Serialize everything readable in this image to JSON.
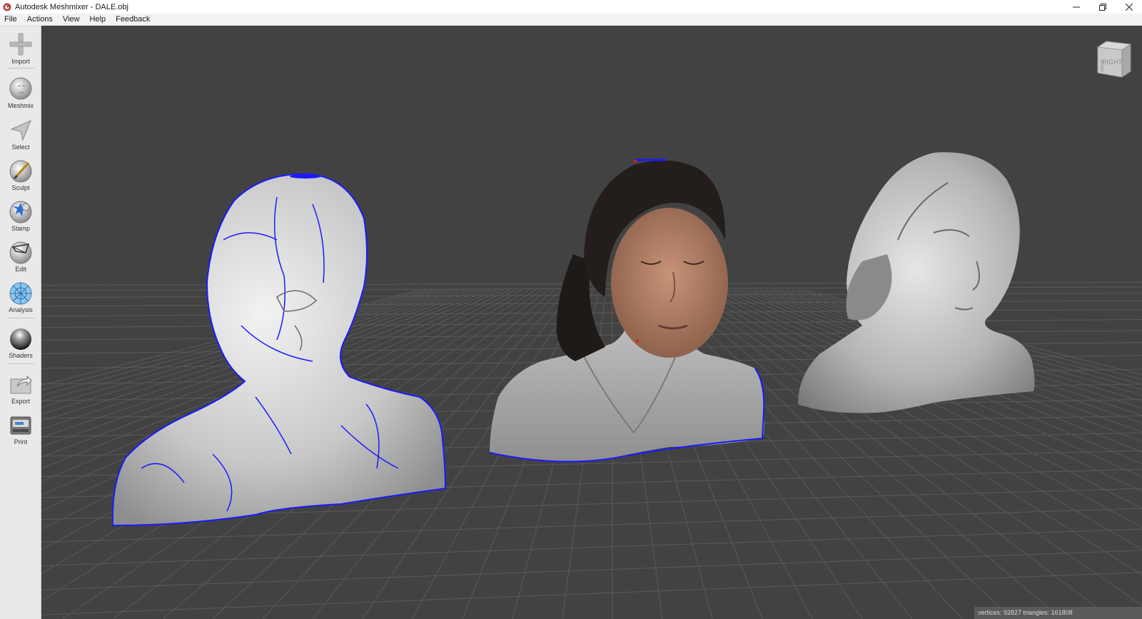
{
  "window": {
    "title": "Autodesk Meshmixer - DALE.obj",
    "minimize_icon": "minimize-icon",
    "restore_icon": "restore-icon",
    "close_icon": "close-icon"
  },
  "menu": {
    "items": [
      {
        "label": "File"
      },
      {
        "label": "Actions"
      },
      {
        "label": "View"
      },
      {
        "label": "Help"
      },
      {
        "label": "Feedback"
      }
    ]
  },
  "toolbar": {
    "tools": [
      {
        "label": "Import",
        "icon": "plus-icon"
      },
      {
        "label": "Meshmix",
        "icon": "meshmix-head-icon"
      },
      {
        "label": "Select",
        "icon": "select-arrow-icon"
      },
      {
        "label": "Sculpt",
        "icon": "sculpt-brush-icon"
      },
      {
        "label": "Stamp",
        "icon": "stamp-icon"
      },
      {
        "label": "Edit",
        "icon": "edit-icon"
      },
      {
        "label": "Analysis",
        "icon": "analysis-icon"
      },
      {
        "label": "Shaders",
        "icon": "shaders-sphere-icon"
      },
      {
        "label": "Export",
        "icon": "export-icon"
      },
      {
        "label": "Print",
        "icon": "print-icon"
      }
    ]
  },
  "viewport": {
    "background_color": "#424242",
    "grid_color": "#5a5a5a",
    "selection_outline_color": "#1a1aff",
    "view_cube": {
      "face_label": "RIGHT",
      "side_label": "FRONT"
    },
    "models": [
      {
        "name": "wireframe-selected-bust",
        "shading": "white-grey with blue selection outline"
      },
      {
        "name": "textured-bust",
        "shading": "photo texture with blue boundary"
      },
      {
        "name": "grey-bust",
        "shading": "grey shaded"
      }
    ]
  },
  "status": {
    "text": "vertices: 92827 triangles: 161808"
  }
}
